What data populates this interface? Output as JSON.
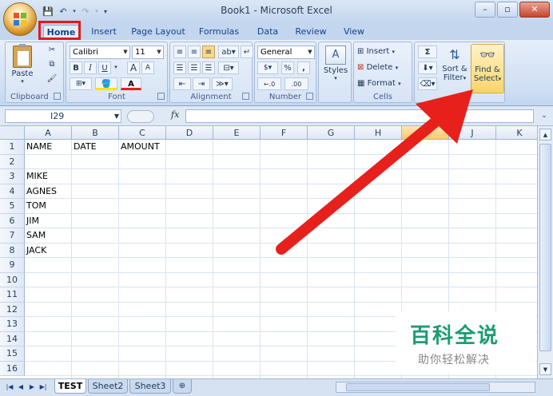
{
  "window": {
    "title": "Book1 - Microsoft Excel"
  },
  "tabs": [
    {
      "label": "Home",
      "active": true
    },
    {
      "label": "Insert"
    },
    {
      "label": "Page Layout"
    },
    {
      "label": "Formulas"
    },
    {
      "label": "Data"
    },
    {
      "label": "Review"
    },
    {
      "label": "View"
    }
  ],
  "ribbon": {
    "clipboard": {
      "label": "Clipboard",
      "paste": "Paste"
    },
    "font": {
      "label": "Font",
      "name": "Calibri",
      "size": "11",
      "bold": "B",
      "italic": "I",
      "underline": "U",
      "grow": "A",
      "shrink": "A",
      "color": "A"
    },
    "alignment": {
      "label": "Alignment"
    },
    "number": {
      "label": "Number",
      "format": "General",
      "percent": "%",
      "comma": ",",
      "dec_inc": "←.0",
      "dec_dec": ".00"
    },
    "styles": {
      "label": "Styles"
    },
    "cells": {
      "label": "Cells",
      "insert": "Insert",
      "delete": "Delete",
      "format": "Format"
    },
    "editing": {
      "sort_line1": "Sort &",
      "sort_line2": "Filter",
      "find_line1": "Find &",
      "find_line2": "Select",
      "sigma": "Σ"
    }
  },
  "formula_bar": {
    "name_box": "I29",
    "fx": "fx",
    "value": ""
  },
  "columns": [
    "A",
    "B",
    "C",
    "D",
    "E",
    "F",
    "G",
    "H",
    "I",
    "J",
    "K"
  ],
  "rows": [
    "1",
    "2",
    "3",
    "4",
    "5",
    "6",
    "7",
    "8",
    "9",
    "10",
    "11",
    "12",
    "13",
    "14",
    "15",
    "16"
  ],
  "cells": {
    "A1": "NAME",
    "B1": "DATE",
    "C1": "AMOUNT",
    "A3": "MIKE",
    "A4": "AGNES",
    "A5": "TOM",
    "A6": "JIM",
    "A7": "SAM",
    "A8": "JACK"
  },
  "sheets": [
    {
      "name": "TEST",
      "active": true
    },
    {
      "name": "Sheet2"
    },
    {
      "name": "Sheet3"
    }
  ],
  "watermark": {
    "title": "百科全说",
    "subtitle": "助你轻松解决"
  },
  "colors": {
    "annotation_red": "#e8201c",
    "brand_green": "#1a9d6f"
  }
}
